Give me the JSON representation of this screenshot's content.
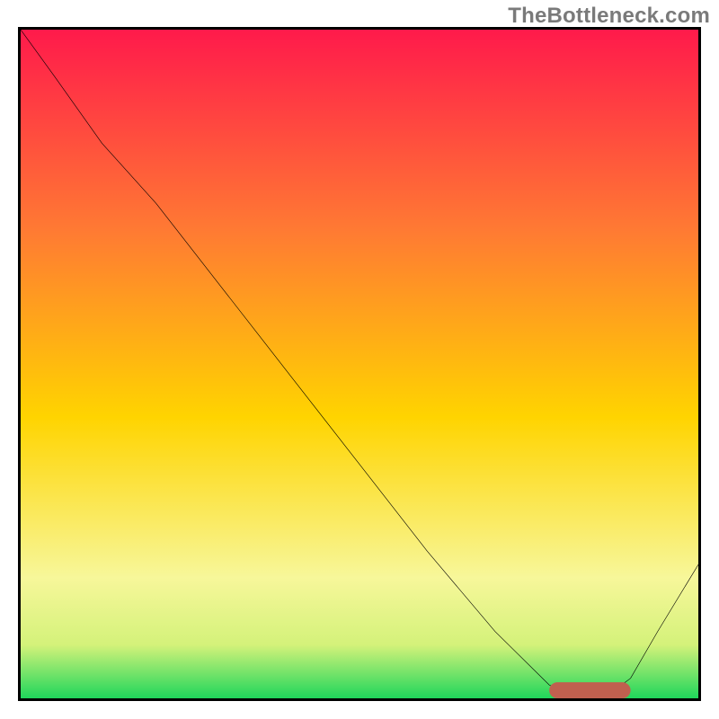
{
  "watermark": "TheBottleneck.com",
  "colors": {
    "gradient_top": "#ff1a4b",
    "gradient_mid_upper": "#ff7a33",
    "gradient_mid": "#ffd400",
    "gradient_low1": "#f7f79a",
    "gradient_low2": "#d4f27a",
    "gradient_bottom": "#1fd65b",
    "curve": "#000000",
    "marker": "#c0604f",
    "border": "#000000"
  },
  "chart_data": {
    "type": "line",
    "title": "",
    "xlabel": "",
    "ylabel": "",
    "xlim": [
      0,
      100
    ],
    "ylim": [
      0,
      100
    ],
    "grid": false,
    "series": [
      {
        "name": "curve",
        "x": [
          0,
          5,
          12,
          20,
          30,
          40,
          50,
          60,
          70,
          78,
          82,
          86,
          90,
          94,
          100
        ],
        "y": [
          100,
          93,
          83,
          74,
          61,
          48,
          35,
          22,
          10,
          2,
          0,
          0,
          3,
          10,
          20
        ]
      }
    ],
    "marker": {
      "x_start": 78,
      "x_end": 90,
      "y": 1.2,
      "thickness": 2.4
    },
    "notes": "y is percentage height from bottom; values estimated from pixel positions"
  }
}
